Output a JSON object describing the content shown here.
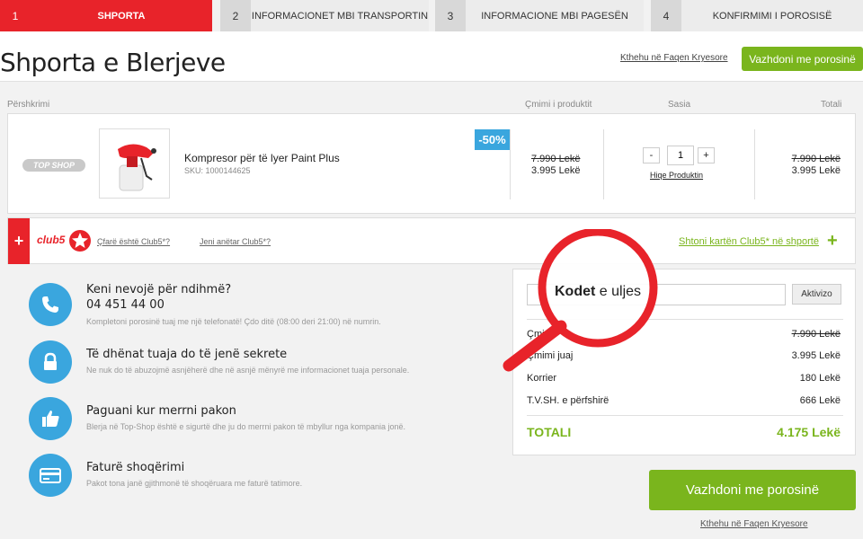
{
  "steps": [
    {
      "num": "1",
      "label": "SHPORTA"
    },
    {
      "num": "2",
      "label": "INFORMACIONET MBI TRANSPORTIN"
    },
    {
      "num": "3",
      "label": "INFORMACIONE MBI PAGESËN"
    },
    {
      "num": "4",
      "label": "KONFIRMIMI I POROSISË"
    }
  ],
  "header": {
    "title": "Shporta e Blerjeve",
    "back_link": "Kthehu në Faqen Kryesore",
    "continue": "Vazhdoni me porosinë"
  },
  "columns": {
    "description": "Përshkrimi",
    "price": "Çmimi i produktit",
    "qty": "Sasia",
    "total": "Totali"
  },
  "product": {
    "brand": "TOP SHOP",
    "name": "Kompresor për të lyer Paint Plus",
    "sku": "SKU: 1000144625",
    "discount": "-50%",
    "old_price": "7.990 Lekë",
    "new_price": "3.995 Lekë",
    "qty": "1",
    "qty_minus": "-",
    "qty_plus": "+",
    "remove": "Hiqe Produktin",
    "total_old": "7.990 Lekë",
    "total_new": "3.995 Lekë"
  },
  "club": {
    "plus": "+",
    "logo": "club5",
    "link_what": "Çfarë është Club5*?",
    "link_members": "Jeni anëtar Club5*?",
    "add": "Shtoni kartën Club5* në shportë",
    "add_plus": "+"
  },
  "info": [
    {
      "icon": "phone-icon",
      "title": "Keni nevojë për ndihmë?",
      "phone": "04 451 44 00",
      "text": "Kompletoni porosinë tuaj me një telefonatë! Çdo ditë (08:00 deri 21:00) në numrin."
    },
    {
      "icon": "lock-icon",
      "title": "Të dhënat tuaja do të jenë sekrete",
      "text": "Ne nuk do të abuzojmë asnjëherë dhe në asnjë mënyrë me informacionet tuaja personale."
    },
    {
      "icon": "thumbs-up-icon",
      "title": "Paguani kur merrni pakon",
      "text": "Blerja në Top-Shop është e sigurtë dhe ju do merrni pakon të mbyllur nga kompania jonë."
    },
    {
      "icon": "credit-card-icon",
      "title": "Faturë shoqërimi",
      "text": "Pakot tona janë gjithmonë të shoqëruara me faturë tatimore."
    }
  ],
  "summary": {
    "coupon_placeholder": "",
    "coupon_btn": "Aktivizo",
    "rows": [
      {
        "label": "Çmimi",
        "value": "7.990 Lekë"
      },
      {
        "label": "Çmimi juaj",
        "value": "3.995 Lekë"
      },
      {
        "label": "Korrier",
        "value": "180 Lekë"
      },
      {
        "label": "T.V.SH. e përfshirë",
        "value": "666 Lekë"
      }
    ],
    "total_label": "TOTALI",
    "total_value": "4.175 Lekë"
  },
  "magnifier": {
    "bold": "Kodet",
    "rest": "e uljes"
  },
  "footer": {
    "continue": "Vazhdoni me porosinë",
    "back_link": "Kthehu në Faqen Kryesore"
  },
  "colors": {
    "red": "#e8232a",
    "green": "#7ab51d",
    "blue": "#3aa6de"
  }
}
